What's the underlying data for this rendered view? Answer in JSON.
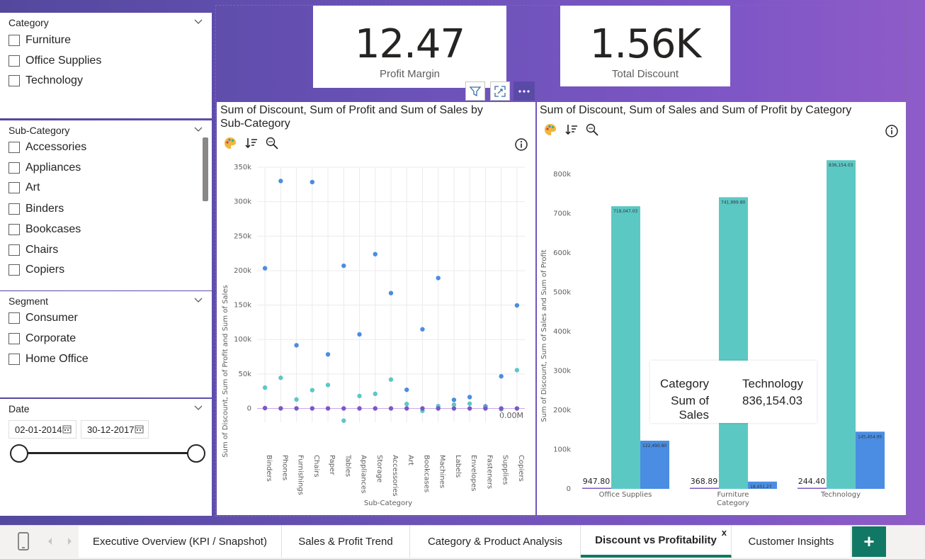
{
  "slicers": {
    "category": {
      "title": "Category",
      "items": [
        "Furniture",
        "Office Supplies",
        "Technology"
      ]
    },
    "sub_category": {
      "title": "Sub-Category",
      "items": [
        "Accessories",
        "Appliances",
        "Art",
        "Binders",
        "Bookcases",
        "Chairs",
        "Copiers"
      ]
    },
    "segment": {
      "title": "Segment",
      "items": [
        "Consumer",
        "Corporate",
        "Home Office"
      ]
    },
    "date": {
      "title": "Date",
      "start": "02-01-2014",
      "end": "30-12-2017"
    }
  },
  "kpis": [
    {
      "value": "12.47",
      "label": "Profit Margin"
    },
    {
      "value": "1.56K",
      "label": "Total Discount"
    }
  ],
  "visual_header": {
    "icons": [
      "filter-icon",
      "focus-mode-icon",
      "more-options-icon"
    ]
  },
  "scatter_visual": {
    "title": "Sum of Discount, Sum of Profit and Sum of Sales by Sub-Category",
    "icons": [
      "palette-icon",
      "sort-icon",
      "zoom-icon",
      "info-icon"
    ],
    "end_label": "0.00M"
  },
  "bar_visual": {
    "title": "Sum of Discount, Sum of Sales and Sum of Profit by Category",
    "icons": [
      "palette-icon",
      "sort-icon",
      "zoom-icon",
      "info-icon"
    ]
  },
  "tooltip": {
    "rows": [
      {
        "key": "Category",
        "value": "Technology"
      },
      {
        "key": "Sum of Sales",
        "value": "836,154.03"
      }
    ]
  },
  "tabs": {
    "items": [
      "Executive Overview (KPI / Snapshot)",
      "Sales & Profit Trend",
      "Category & Product Analysis",
      "Discount vs Profitability",
      "Customer Insights"
    ],
    "active_index": 3,
    "close_label": "x",
    "add_label": "+"
  },
  "colors": {
    "sales": "#4a8de2",
    "profit": "#5cc8c4",
    "discount": "#7b57c3",
    "accent": "#117865"
  },
  "chart_data": [
    {
      "type": "scatter",
      "title": "Sum of Discount, Sum of Profit and Sum of Sales by Sub-Category",
      "xlabel": "Sub-Category",
      "ylabel": "Sum of Discount, Sum of Profit and Sum of Sales",
      "categories": [
        "Binders",
        "Phones",
        "Furnishings",
        "Chairs",
        "Paper",
        "Tables",
        "Appliances",
        "Storage",
        "Accessories",
        "Art",
        "Bookcases",
        "Machines",
        "Labels",
        "Envelopes",
        "Fasteners",
        "Supplies",
        "Copiers"
      ],
      "y_ticks": [
        "0",
        "50k",
        "100k",
        "150k",
        "200k",
        "250k",
        "300k",
        "350k"
      ],
      "ylim": [
        -20000,
        350000
      ],
      "series": [
        {
          "name": "Sum of Sales",
          "values": [
            203413,
            330007,
            91705,
            328449,
            78479,
            206966,
            107532,
            223844,
            167380,
            27119,
            114880,
            189239,
            12486,
            16476,
            3024,
            46674,
            149528
          ]
        },
        {
          "name": "Sum of Profit",
          "values": [
            30222,
            44516,
            13059,
            26590,
            34054,
            -17725,
            18138,
            21279,
            41937,
            6528,
            -3473,
            3385,
            5546,
            6964,
            950,
            -1189,
            55618
          ]
        },
        {
          "name": "Sum of Discount",
          "values": [
            567,
            137,
            133,
            106,
            103,
            83,
            78,
            63,
            60,
            59,
            48,
            35,
            25,
            20,
            18,
            14,
            11
          ]
        }
      ],
      "grid": true
    },
    {
      "type": "bar",
      "title": "Sum of Discount, Sum of Sales and Sum of Profit by Category",
      "xlabel": "Category",
      "ylabel": "Sum of Discount, Sum of Sales and Sum of Profit",
      "categories": [
        "Office Supplies",
        "Furniture",
        "Technology"
      ],
      "y_ticks": [
        "0",
        "100k",
        "200k",
        "300k",
        "400k",
        "500k",
        "600k",
        "700k",
        "800k"
      ],
      "ylim": [
        0,
        840000
      ],
      "series": [
        {
          "name": "Sum of Discount",
          "values": [
            947.8,
            368.89,
            244.4
          ],
          "labels": [
            "947.80",
            "368.89",
            "244.40"
          ]
        },
        {
          "name": "Sum of Sales",
          "values": [
            719047.03,
            741999.8,
            836154.03
          ],
          "labels": [
            "719,047.03",
            "741,999.80",
            "836,154.03"
          ]
        },
        {
          "name": "Sum of Profit",
          "values": [
            122490.8,
            18451.27,
            145454.95
          ],
          "labels": [
            "122,490.80",
            "18,451.27",
            "145,454.95"
          ]
        }
      ],
      "grid": false
    }
  ]
}
